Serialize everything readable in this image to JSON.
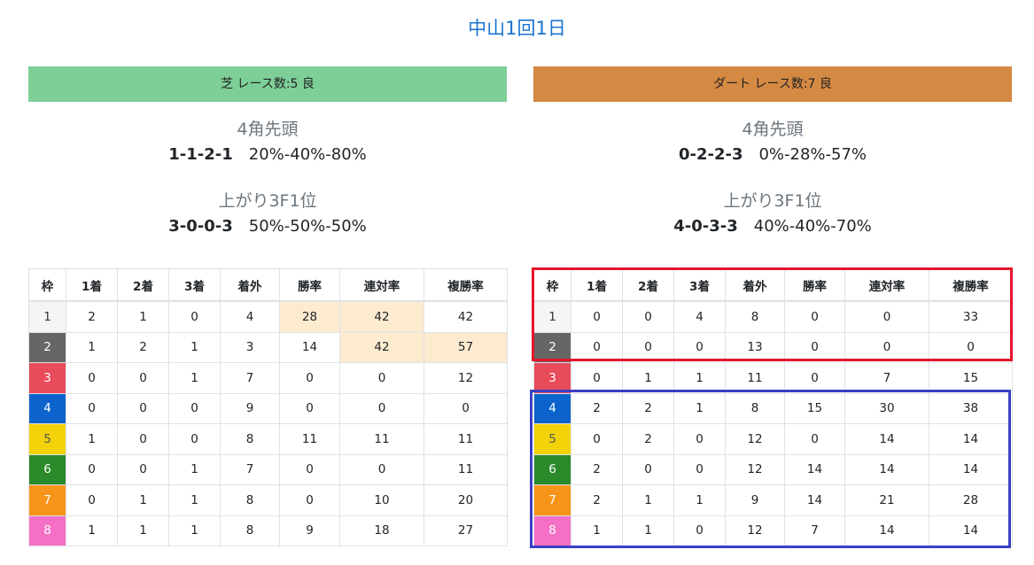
{
  "page_title": "中山1回1日",
  "turf": {
    "banner": "芝 レース数:5 良",
    "banner_color": "#7dcf97",
    "corner_label": "4角先頭",
    "corner_counts": "1-1-2-1",
    "corner_rates": "20%-40%-80%",
    "agari_label": "上がり3F1位",
    "agari_counts": "3-0-0-3",
    "agari_rates": "50%-50%-50%",
    "headers": [
      "枠",
      "1着",
      "2着",
      "3着",
      "着外",
      "勝率",
      "連対率",
      "複勝率"
    ],
    "rows": [
      [
        "1",
        "2",
        "1",
        "0",
        "4",
        "28",
        "42",
        "42"
      ],
      [
        "2",
        "1",
        "2",
        "1",
        "3",
        "14",
        "42",
        "57"
      ],
      [
        "3",
        "0",
        "0",
        "1",
        "7",
        "0",
        "0",
        "12"
      ],
      [
        "4",
        "0",
        "0",
        "0",
        "9",
        "0",
        "0",
        "0"
      ],
      [
        "5",
        "1",
        "0",
        "0",
        "8",
        "11",
        "11",
        "11"
      ],
      [
        "6",
        "0",
        "0",
        "1",
        "7",
        "0",
        "0",
        "11"
      ],
      [
        "7",
        "0",
        "1",
        "1",
        "8",
        "0",
        "10",
        "20"
      ],
      [
        "8",
        "1",
        "1",
        "1",
        "8",
        "9",
        "18",
        "27"
      ]
    ],
    "highlight_color": "#fdebd0"
  },
  "dirt": {
    "banner": "ダート レース数:7 良",
    "banner_color": "#d58a43",
    "corner_label": "4角先頭",
    "corner_counts": "0-2-2-3",
    "corner_rates": "0%-28%-57%",
    "agari_label": "上がり3F1位",
    "agari_counts": "4-0-3-3",
    "agari_rates": "40%-40%-70%",
    "headers": [
      "枠",
      "1着",
      "2着",
      "3着",
      "着外",
      "勝率",
      "連対率",
      "複勝率"
    ],
    "rows": [
      [
        "1",
        "0",
        "0",
        "4",
        "8",
        "0",
        "0",
        "33"
      ],
      [
        "2",
        "0",
        "0",
        "0",
        "13",
        "0",
        "0",
        "0"
      ],
      [
        "3",
        "0",
        "1",
        "1",
        "11",
        "0",
        "7",
        "15"
      ],
      [
        "4",
        "2",
        "2",
        "1",
        "8",
        "15",
        "30",
        "38"
      ],
      [
        "5",
        "0",
        "2",
        "0",
        "12",
        "0",
        "14",
        "14"
      ],
      [
        "6",
        "2",
        "0",
        "0",
        "12",
        "14",
        "14",
        "14"
      ],
      [
        "7",
        "2",
        "1",
        "1",
        "9",
        "14",
        "21",
        "28"
      ],
      [
        "8",
        "1",
        "1",
        "0",
        "12",
        "7",
        "14",
        "14"
      ]
    ]
  },
  "annotation_colors": {
    "red_box": "#e4142b",
    "blue_box": "#3c3fc4"
  }
}
